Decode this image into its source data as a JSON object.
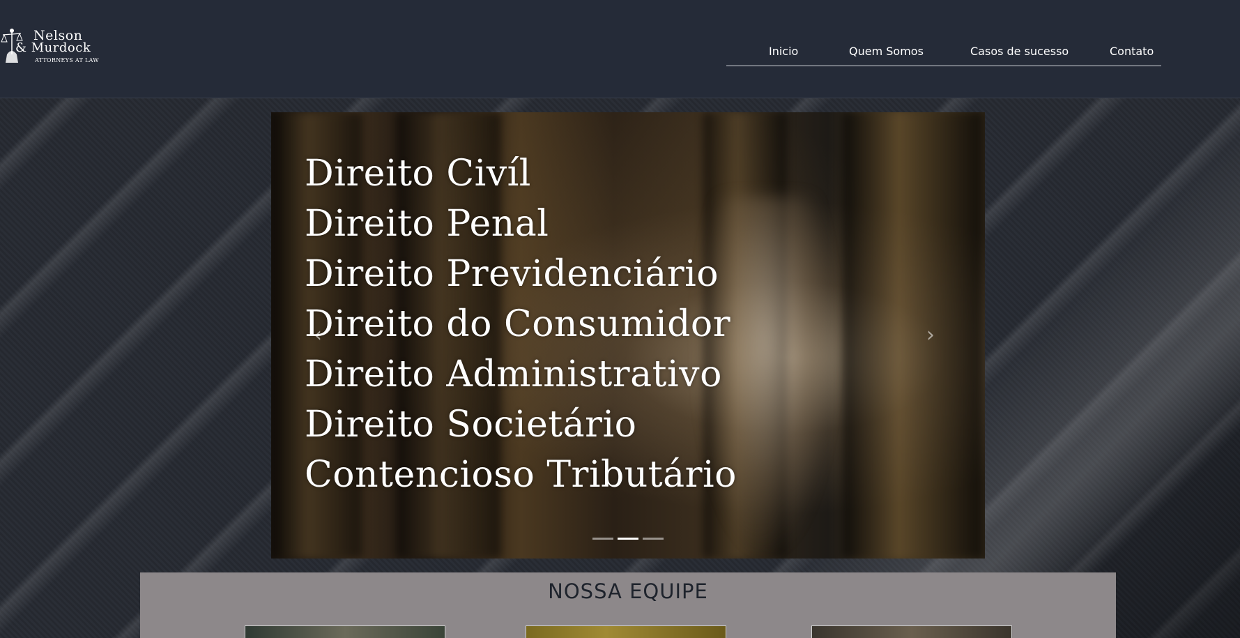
{
  "header": {
    "logo": {
      "line1": "Nelson",
      "line2": "& Murdock",
      "line3": "Attorneys at Law"
    },
    "nav": [
      {
        "label": "Inicio"
      },
      {
        "label": "Quem Somos"
      },
      {
        "label": "Casos de sucesso"
      },
      {
        "label": "Contato"
      }
    ]
  },
  "carousel": {
    "lines": [
      "Direito Civíl",
      "Direito Penal",
      "Direito Previdenciário",
      "Direito do Consumidor",
      "Direito Administrativo",
      "Direito Societário",
      "Contencioso Tributário"
    ],
    "prev_icon": "chevron-left-icon",
    "next_icon": "chevron-right-icon",
    "prev_glyph": "‹",
    "next_glyph": "›",
    "indicator_count": 3,
    "active_indicator": 2
  },
  "team": {
    "title": "NOSSA EQUIPE"
  },
  "colors": {
    "header_bg": "#252b38",
    "team_bg": "#8d888a",
    "text_light": "#ffffff",
    "title_dark": "#1e232c"
  }
}
